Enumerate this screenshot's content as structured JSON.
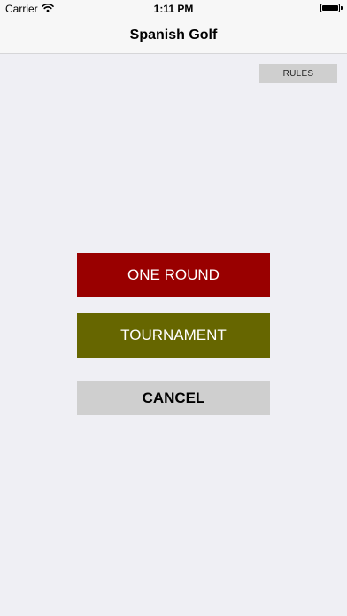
{
  "status_bar": {
    "carrier": "Carrier",
    "time": "1:11 PM",
    "battery_level": 1.0
  },
  "nav": {
    "title": "Spanish Golf"
  },
  "buttons": {
    "rules": "RULES",
    "one_round": "ONE ROUND",
    "tournament": "TOURNAMENT",
    "cancel": "CANCEL"
  },
  "colors": {
    "background": "#efeff4",
    "one_round": "#990000",
    "tournament": "#666600",
    "neutral_button": "#cfcfcf"
  },
  "icons": {
    "wifi": "wifi-icon",
    "battery": "battery-icon"
  }
}
